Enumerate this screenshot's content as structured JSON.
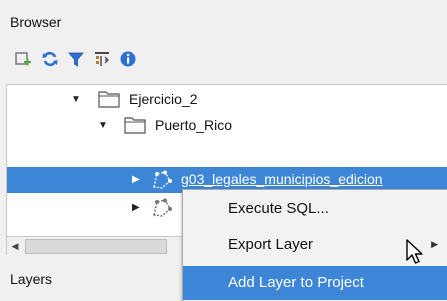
{
  "browser_panel": {
    "title": "Browser",
    "toolbar": [
      {
        "icon": "add-selected-layers-icon",
        "color": "#5aa14a"
      },
      {
        "icon": "refresh-icon",
        "color": "#2f6fd0"
      },
      {
        "icon": "filter-icon",
        "color": "#2f6fd0"
      },
      {
        "icon": "collapse-all-icon",
        "color": "#c47a2a"
      },
      {
        "icon": "info-icon",
        "color": "#2f6fd0"
      }
    ],
    "tree": [
      {
        "label": "Ejercicio_2",
        "expanded": true
      },
      {
        "label": "Puerto_Rico",
        "expanded": true
      },
      {
        "label": "g03_legales_municipios_edicion",
        "selected": true
      }
    ]
  },
  "context_menu": {
    "items": [
      "Execute SQL...",
      "Export Layer",
      "Add Layer to Project"
    ],
    "highlighted": "Add Layer to Project"
  },
  "layers_panel": {
    "title": "Layers"
  },
  "colors": {
    "selection": "#3d86d7",
    "panel_bg": "#f0f0f0"
  }
}
